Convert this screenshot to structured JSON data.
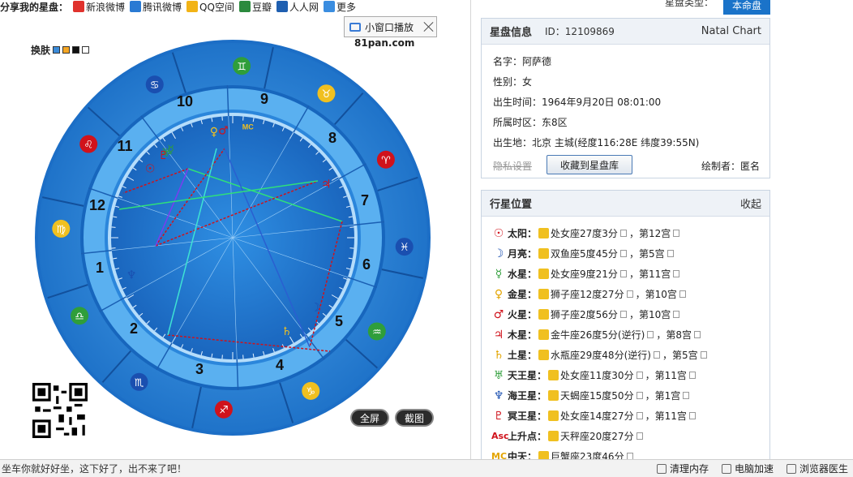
{
  "share": {
    "label": "分享我的星盘：",
    "items": [
      {
        "label": "新浪微博",
        "color": "#e0322d"
      },
      {
        "label": "腾讯微博",
        "color": "#2a7ad3"
      },
      {
        "label": "QQ空间",
        "color": "#f2b316"
      },
      {
        "label": "豆瓣",
        "color": "#2b8a3e"
      },
      {
        "label": "人人网",
        "color": "#1f5fb0"
      },
      {
        "label": "更多",
        "color": "#3a8de0"
      }
    ]
  },
  "mini_window": {
    "label": "小窗口播放"
  },
  "site": "81pan.com",
  "skin": {
    "label": "换肤",
    "colors": [
      "#3b8bd9",
      "#f5a623",
      "#111111",
      "#ffffff"
    ]
  },
  "chart": {
    "houses": [
      "1",
      "2",
      "3",
      "4",
      "5",
      "6",
      "7",
      "8",
      "9",
      "10",
      "11",
      "12"
    ],
    "mc_label": "MC"
  },
  "buttons": {
    "fullscreen": "全屏",
    "screenshot": "截图"
  },
  "chart_type": {
    "label": "星盘类型：",
    "value": "本命盘"
  },
  "info": {
    "title": "星盘信息",
    "id": "ID：12109869",
    "kind": "Natal Chart",
    "name_label": "名字：",
    "name": "阿萨德",
    "gender_label": "性别：",
    "gender": "女",
    "birth_label": "出生时间：",
    "birth": "1964年9月20日 08:01:00",
    "tz_label": "所属时区：",
    "tz": "东8区",
    "place_label": "出生地：",
    "place": "北京 主城(经度116:28E 纬度39:55N)",
    "privacy": "隐私设置",
    "save": "收藏到星盘库",
    "author": "绘制者：匿名"
  },
  "planets": {
    "title": "行星位置",
    "collapse": "收起",
    "rows": [
      {
        "glyph": "☉",
        "color": "#d0121b",
        "name": "太阳",
        "text": "处女座27度3分",
        "house": "第12宫"
      },
      {
        "glyph": "☽",
        "color": "#1a4fb0",
        "name": "月亮",
        "text": "双鱼座5度45分",
        "house": "第5宫"
      },
      {
        "glyph": "☿",
        "color": "#2f9e3a",
        "name": "水星",
        "text": "处女座9度21分",
        "house": "第11宫"
      },
      {
        "glyph": "♀",
        "color": "#e3a400",
        "name": "金星",
        "text": "狮子座12度27分",
        "house": "第10宫"
      },
      {
        "glyph": "♂",
        "color": "#d0121b",
        "name": "火星",
        "text": "狮子座2度56分",
        "house": "第10宫"
      },
      {
        "glyph": "♃",
        "color": "#d0121b",
        "name": "木星",
        "text": "金牛座26度5分(逆行)",
        "house": "第8宫"
      },
      {
        "glyph": "♄",
        "color": "#e3a400",
        "name": "土星",
        "text": "水瓶座29度48分(逆行)",
        "house": "第5宫"
      },
      {
        "glyph": "♅",
        "color": "#2f9e3a",
        "name": "天王星",
        "text": "处女座11度30分",
        "house": "第11宫"
      },
      {
        "glyph": "♆",
        "color": "#1a4fb0",
        "name": "海王星",
        "text": "天蝎座15度50分",
        "house": "第1宫"
      },
      {
        "glyph": "♇",
        "color": "#d0121b",
        "name": "冥王星",
        "text": "处女座14度27分",
        "house": "第11宫"
      },
      {
        "glyph": "Asc",
        "color": "#d0121b",
        "name": "上升点",
        "text": "天秤座20度27分",
        "house": ""
      },
      {
        "glyph": "MC",
        "color": "#e3a400",
        "name": "中天",
        "text": "巨蟹座23度46分",
        "house": ""
      }
    ]
  },
  "status": {
    "ticker": "坐车你就好好坐，这下好了，出不来了吧！",
    "tools": [
      "清理内存",
      "电脑加速",
      "浏览器医生"
    ]
  }
}
